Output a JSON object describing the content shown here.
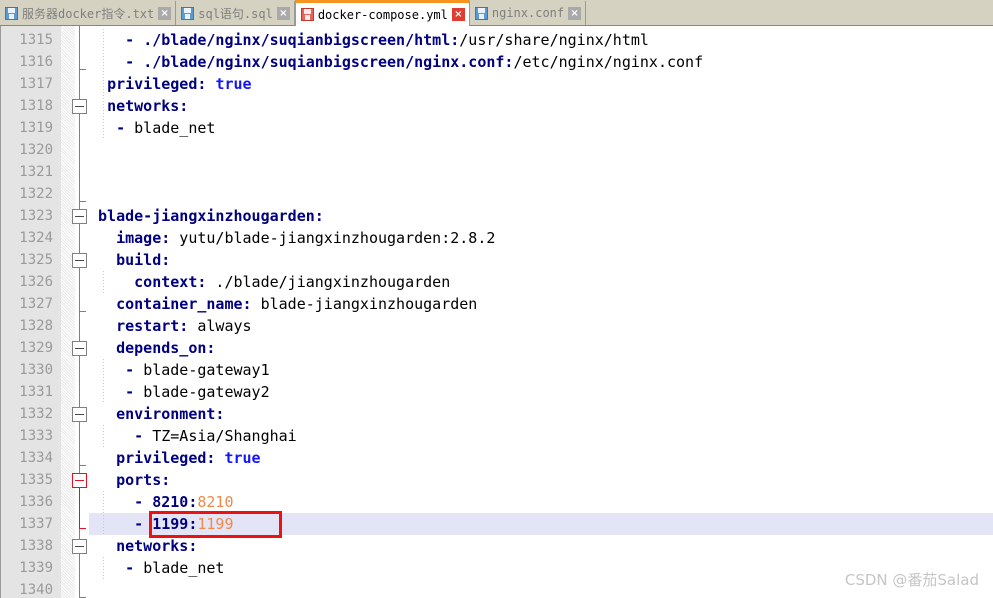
{
  "tabs": [
    {
      "label": "服务器docker指令.txt",
      "icon": "floppy-disk-icon",
      "close": "×",
      "active": false,
      "modified": false
    },
    {
      "label": "sql语句.sql",
      "icon": "floppy-disk-icon",
      "close": "×",
      "active": false,
      "modified": false
    },
    {
      "label": "docker-compose.yml",
      "icon": "floppy-disk-icon",
      "close": "×",
      "active": true,
      "modified": true
    },
    {
      "label": "nginx.conf",
      "icon": "floppy-disk-icon",
      "close": "×",
      "active": false,
      "modified": false
    }
  ],
  "colors": {
    "accent_tab": "#f79421",
    "key": "#000080",
    "bool": "#1414ff",
    "port_mapped": "#f08a4b",
    "annotation": "#ee1111",
    "current_line": "#e4e4f7",
    "gutter_bg": "#e4e4e4",
    "tabbar_bg": "#d6d2c2"
  },
  "editor": {
    "first_line_number": 1315,
    "lines": [
      {
        "n": 1315,
        "segments": [
          {
            "t": "    ",
            "c": "plain"
          },
          {
            "t": "- ",
            "c": "dash"
          },
          {
            "t": "./blade/nginx/suqianbigscreen/html",
            "c": "key"
          },
          {
            "t": ":",
            "c": "key"
          },
          {
            "t": "/usr/share/nginx/html",
            "c": "val"
          }
        ]
      },
      {
        "n": 1316,
        "segments": [
          {
            "t": "    ",
            "c": "plain"
          },
          {
            "t": "- ",
            "c": "dash"
          },
          {
            "t": "./blade/nginx/suqianbigscreen/nginx.conf",
            "c": "key"
          },
          {
            "t": ":",
            "c": "key"
          },
          {
            "t": "/etc/nginx/nginx.conf",
            "c": "val"
          }
        ]
      },
      {
        "n": 1317,
        "segments": [
          {
            "t": "  ",
            "c": "plain"
          },
          {
            "t": "privileged:",
            "c": "key"
          },
          {
            "t": " ",
            "c": "val"
          },
          {
            "t": "true",
            "c": "bool"
          }
        ]
      },
      {
        "n": 1318,
        "segments": [
          {
            "t": "  ",
            "c": "plain"
          },
          {
            "t": "networks:",
            "c": "key"
          }
        ]
      },
      {
        "n": 1319,
        "segments": [
          {
            "t": "   ",
            "c": "plain"
          },
          {
            "t": "- ",
            "c": "dash"
          },
          {
            "t": "blade_net",
            "c": "val"
          }
        ]
      },
      {
        "n": 1320,
        "segments": []
      },
      {
        "n": 1321,
        "segments": []
      },
      {
        "n": 1322,
        "segments": []
      },
      {
        "n": 1323,
        "segments": [
          {
            "t": " ",
            "c": "plain"
          },
          {
            "t": "blade-jiangxinzhougarden:",
            "c": "key"
          }
        ]
      },
      {
        "n": 1324,
        "segments": [
          {
            "t": "   ",
            "c": "plain"
          },
          {
            "t": "image:",
            "c": "key"
          },
          {
            "t": " yutu/blade-jiangxinzhougarden:2.8.2",
            "c": "val"
          }
        ]
      },
      {
        "n": 1325,
        "segments": [
          {
            "t": "   ",
            "c": "plain"
          },
          {
            "t": "build:",
            "c": "key"
          }
        ]
      },
      {
        "n": 1326,
        "segments": [
          {
            "t": "     ",
            "c": "plain"
          },
          {
            "t": "context:",
            "c": "key"
          },
          {
            "t": " ./blade/jiangxinzhougarden",
            "c": "val"
          }
        ]
      },
      {
        "n": 1327,
        "segments": [
          {
            "t": "   ",
            "c": "plain"
          },
          {
            "t": "container_name:",
            "c": "key"
          },
          {
            "t": " blade-jiangxinzhougarden",
            "c": "val"
          }
        ]
      },
      {
        "n": 1328,
        "segments": [
          {
            "t": "   ",
            "c": "plain"
          },
          {
            "t": "restart:",
            "c": "key"
          },
          {
            "t": " always",
            "c": "val"
          }
        ]
      },
      {
        "n": 1329,
        "segments": [
          {
            "t": "   ",
            "c": "plain"
          },
          {
            "t": "depends_on:",
            "c": "key"
          }
        ]
      },
      {
        "n": 1330,
        "segments": [
          {
            "t": "    ",
            "c": "plain"
          },
          {
            "t": "- ",
            "c": "dash"
          },
          {
            "t": "blade-gateway1",
            "c": "val"
          }
        ]
      },
      {
        "n": 1331,
        "segments": [
          {
            "t": "    ",
            "c": "plain"
          },
          {
            "t": "- ",
            "c": "dash"
          },
          {
            "t": "blade-gateway2",
            "c": "val"
          }
        ]
      },
      {
        "n": 1332,
        "segments": [
          {
            "t": "   ",
            "c": "plain"
          },
          {
            "t": "environment:",
            "c": "key"
          }
        ]
      },
      {
        "n": 1333,
        "segments": [
          {
            "t": "     ",
            "c": "plain"
          },
          {
            "t": "- ",
            "c": "dash"
          },
          {
            "t": "TZ=Asia/Shanghai",
            "c": "val"
          }
        ]
      },
      {
        "n": 1334,
        "segments": [
          {
            "t": "   ",
            "c": "plain"
          },
          {
            "t": "privileged:",
            "c": "key"
          },
          {
            "t": " ",
            "c": "val"
          },
          {
            "t": "true",
            "c": "bool"
          }
        ]
      },
      {
        "n": 1335,
        "segments": [
          {
            "t": "   ",
            "c": "plain"
          },
          {
            "t": "ports:",
            "c": "key"
          }
        ]
      },
      {
        "n": 1336,
        "segments": [
          {
            "t": "     ",
            "c": "plain"
          },
          {
            "t": "- ",
            "c": "dash"
          },
          {
            "t": "8210",
            "c": "key"
          },
          {
            "t": ":",
            "c": "key"
          },
          {
            "t": "8210",
            "c": "num2"
          }
        ]
      },
      {
        "n": 1337,
        "highlight": true,
        "segments": [
          {
            "t": "     ",
            "c": "plain"
          },
          {
            "t": "- ",
            "c": "dash"
          },
          {
            "t": "1199",
            "c": "key"
          },
          {
            "t": ":",
            "c": "key"
          },
          {
            "t": "1199",
            "c": "num2"
          }
        ]
      },
      {
        "n": 1338,
        "segments": [
          {
            "t": "   ",
            "c": "plain"
          },
          {
            "t": "networks:",
            "c": "key"
          }
        ]
      },
      {
        "n": 1339,
        "segments": [
          {
            "t": "    ",
            "c": "plain"
          },
          {
            "t": "- ",
            "c": "dash"
          },
          {
            "t": "blade_net",
            "c": "val"
          }
        ]
      },
      {
        "n": 1340,
        "segments": []
      }
    ],
    "fold_markers": [
      {
        "line": 1316,
        "type": "tick"
      },
      {
        "line": 1318,
        "type": "box"
      },
      {
        "line": 1322,
        "type": "tick"
      },
      {
        "line": 1323,
        "type": "box"
      },
      {
        "line": 1325,
        "type": "box"
      },
      {
        "line": 1327,
        "type": "tick"
      },
      {
        "line": 1329,
        "type": "box"
      },
      {
        "line": 1332,
        "type": "box"
      },
      {
        "line": 1334,
        "type": "tick"
      },
      {
        "line": 1335,
        "type": "box-red"
      },
      {
        "line": 1338,
        "type": "box"
      },
      {
        "line": 1340,
        "type": "tick"
      }
    ]
  },
  "annotation": {
    "target_line": 1337,
    "label": "red-highlight-box"
  },
  "watermark": {
    "text": "CSDN @番茄Salad"
  }
}
